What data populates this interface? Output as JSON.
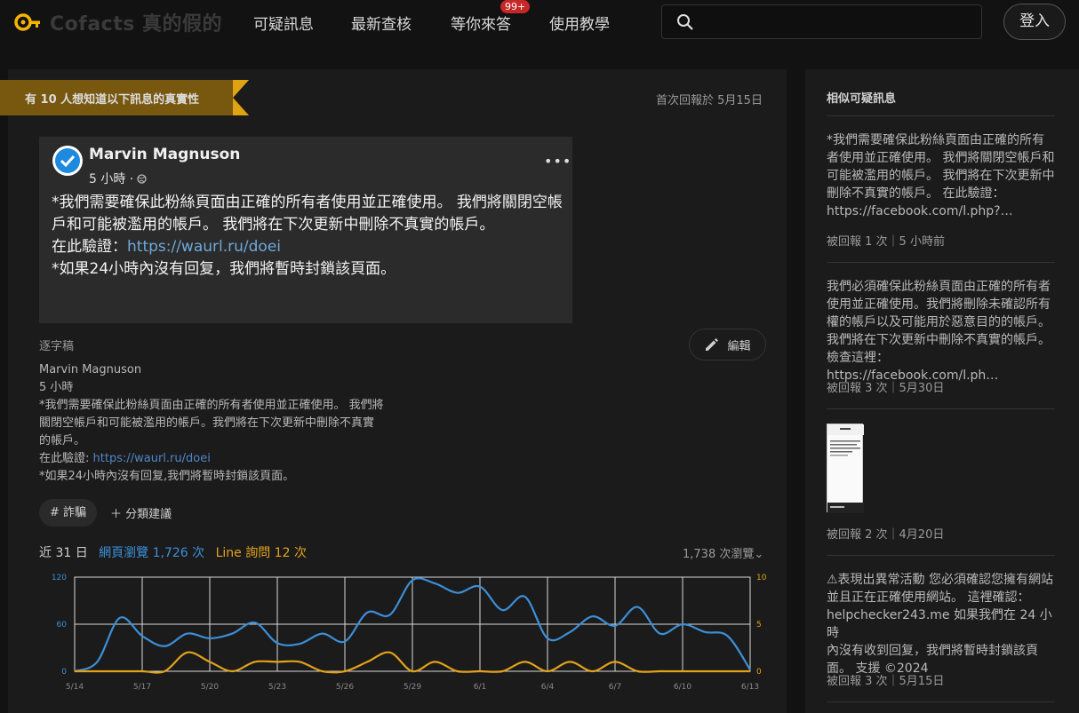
{
  "header": {
    "logo_text": "Cofacts 真的假的",
    "nav": [
      "可疑訊息",
      "最新查核",
      "等你來答",
      "使用教學"
    ],
    "badge": "99+",
    "search_placeholder": "",
    "login": "登入"
  },
  "main": {
    "ribbon": "有 10 人想知道以下訊息的真實性",
    "first_report": "首次回報於 5月15日",
    "post": {
      "name": "Marvin Magnuson",
      "time": "5 小時 ·",
      "more": "•••",
      "line1": "*我們需要確保此粉絲頁面由正確的所有者使用並正確使用。 我們將關閉空帳戶和可能被濫用的帳戶。 我們將在下次更新中刪除不真實的帳戶。",
      "verify_prefix": "在此驗證：",
      "link": "https://waurl.ru/doei",
      "line3": "*如果24小時內沒有回复，我們將暫時封鎖該頁面。"
    },
    "transcript_label": "逐字稿",
    "edit": "編輯",
    "transcript": {
      "name": "Marvin Magnuson",
      "time": "5 小時",
      "l1": "*我們需要確保此粉絲頁面由正確的所有者使用並正確使用。 我們將",
      "l2": "關閉空帳戶和可能被濫用的帳戶。我們將在下次更新中刪除不真實",
      "l3": "的帳戶。",
      "verify_prefix": "在此驗證: ",
      "link": "https://waurl.ru/doei",
      "l5": "*如果24小時內沒有回复,我們將暫時封鎖該頁面。"
    },
    "tag": "# 詐騙",
    "category_suggest": "＋ 分類建議",
    "stats": {
      "days": "近 31 日",
      "web": "網頁瀏覽 1,726 次",
      "line": "Line 詢問 12 次",
      "total": "1,738 次瀏覽"
    }
  },
  "chart_data": {
    "type": "line",
    "x": [
      "5/14",
      "5/15",
      "5/16",
      "5/17",
      "5/18",
      "5/19",
      "5/20",
      "5/21",
      "5/22",
      "5/23",
      "5/24",
      "5/25",
      "5/26",
      "5/27",
      "5/28",
      "5/29",
      "5/30",
      "5/31",
      "6/1",
      "6/2",
      "6/3",
      "6/4",
      "6/5",
      "6/6",
      "6/7",
      "6/8",
      "6/9",
      "6/10",
      "6/11",
      "6/12",
      "6/13"
    ],
    "x_ticks": [
      "5/14",
      "5/17",
      "5/20",
      "5/23",
      "5/26",
      "5/29",
      "6/1",
      "6/4",
      "6/7",
      "6/10",
      "6/13"
    ],
    "left_axis_ticks": [
      "120",
      "60",
      "0"
    ],
    "right_axis_ticks": [
      "10",
      "5",
      "0"
    ],
    "ylim_left": [
      0,
      120
    ],
    "ylim_right": [
      0,
      10
    ],
    "series": [
      {
        "name": "網頁瀏覽",
        "axis": "left",
        "color": "#3c8fd8",
        "values": [
          0,
          12,
          68,
          45,
          32,
          48,
          42,
          48,
          62,
          36,
          35,
          48,
          38,
          75,
          72,
          116,
          112,
          100,
          108,
          78,
          95,
          42,
          50,
          70,
          58,
          82,
          48,
          60,
          50,
          45,
          2
        ]
      },
      {
        "name": "Line 詢問",
        "axis": "right",
        "color": "#e3a21a",
        "values": [
          0,
          0,
          0,
          0,
          0,
          2,
          1,
          0,
          1,
          1,
          1,
          0,
          0,
          1,
          2,
          0,
          1,
          0,
          0,
          0,
          1,
          0,
          1,
          0,
          1,
          0,
          0,
          0,
          0,
          0,
          0
        ]
      }
    ],
    "grid": true
  },
  "sidebar": {
    "title": "相似可疑訊息",
    "items": [
      {
        "lines": [
          "*我們需要確保此粉絲頁面由正確的所有",
          "者使用並正確使用。 我們將關閉空帳戶和",
          "可能被濫用的帳戶。 我們將在下次更新中",
          "刪除不真實的帳戶。 在此驗證：",
          "https://facebook.com/l.php?…"
        ],
        "meta": "被回報 1 次｜5 小時前"
      },
      {
        "lines": [
          "我們必須確保此粉絲頁面由正確的所有者",
          "使用並正確使用。我們將刪除未確認所有",
          "權的帳戶以及可能用於惡意目的的帳戶。",
          "我們將在下次更新中刪除不真實的帳戶。",
          "檢查這裡：https://facebook.com/l.ph…"
        ],
        "meta": "被回報 3 次｜5月30日"
      },
      {
        "lines": [],
        "meta": "被回報 2 次｜4月20日"
      },
      {
        "lines": [
          "⚠表現出異常活動 您必須確認您擁有網站",
          "並且正在正確使用網站。 這裡確認：",
          "helpchecker243.me 如果我們在 24 小時",
          "內沒有收到回复，我們將暫時封鎖該頁",
          "面。 支援 ©2024"
        ],
        "meta": "被回報 3 次｜5月15日"
      }
    ]
  }
}
